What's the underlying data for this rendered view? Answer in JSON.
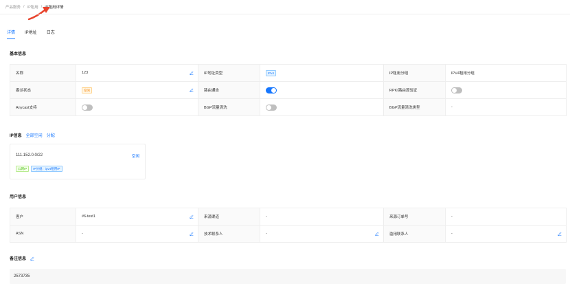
{
  "breadcrumb": {
    "item1": "产品服务",
    "sep1": "/",
    "item2": "IP租用",
    "sep2": "/",
    "current": "IP租用详情"
  },
  "tabs": [
    {
      "label": "详情",
      "active": true
    },
    {
      "label": "IP地址",
      "active": false
    },
    {
      "label": "日志",
      "active": false
    }
  ],
  "basic": {
    "title": "基本信息",
    "name_label": "名称",
    "name_value": "123",
    "iptype_label": "IP地址类型",
    "iptype_value": "IPv4",
    "group_label": "IP租用分组",
    "group_value": "IPV4租用分组",
    "status_label": "委派状态",
    "status_value": "空闲",
    "route_label": "路由通告",
    "route_on": true,
    "rpki_label": "RPKI路由源验证",
    "rpki_on": false,
    "anycast_label": "Anycast支持",
    "anycast_on": false,
    "bgp_label": "BGP流量清洗",
    "bgp_on": false,
    "bgptype_label": "BGP流量清洗类型",
    "bgptype_value": "-"
  },
  "ipinfo": {
    "title": "IP信息",
    "link_all_free": "全部空闲",
    "link_assign": "分配",
    "cidr": "111.152.0.0/22",
    "state": "空闲",
    "tag_public": "公网IP",
    "tag_group": "IP分组：ipv4租用IP"
  },
  "user": {
    "title": "用户信息",
    "customer_label": "客户",
    "customer_value": "#6-test1",
    "source_label": "来源渠道",
    "source_value": "-",
    "order_label": "来源订单号",
    "order_value": "-",
    "asn_label": "ASN",
    "asn_value": "-",
    "tech_label": "技术联系人",
    "tech_value": "-",
    "abuse_label": "滥用联系人",
    "abuse_value": "-"
  },
  "remark": {
    "title": "备注信息",
    "value": "2573735"
  },
  "colors": {
    "accent": "#1677ff",
    "arrow": "#e8432c"
  }
}
